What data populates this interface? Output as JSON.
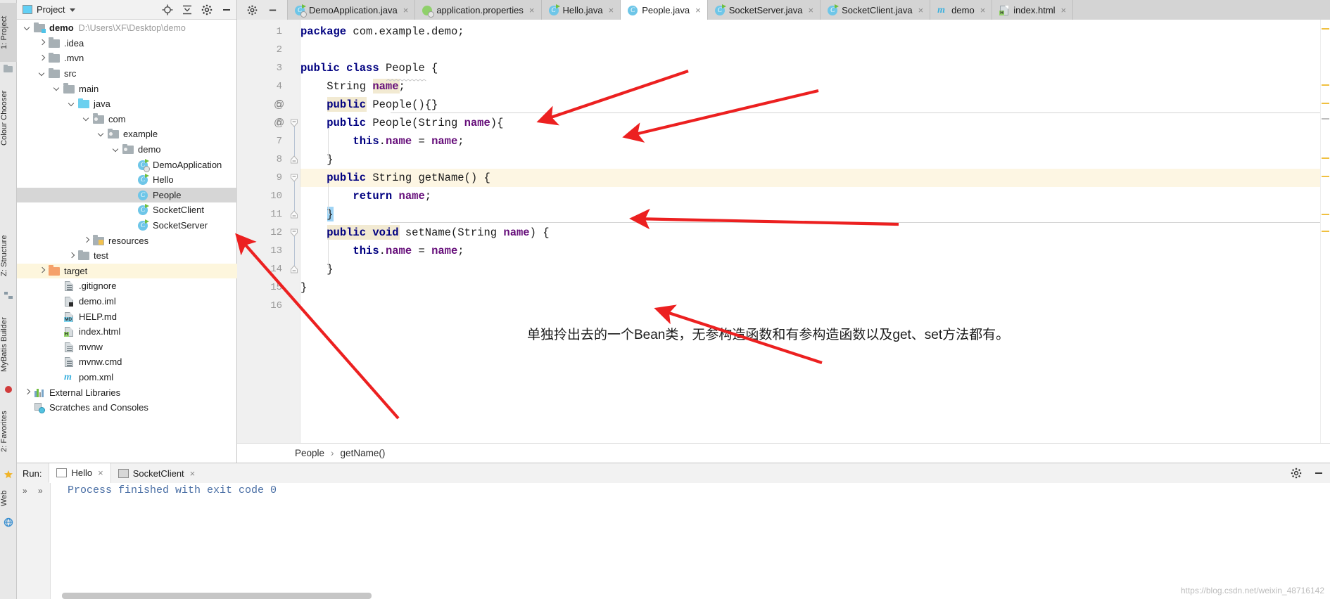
{
  "left_rail": {
    "items": [
      {
        "label": "1: Project",
        "selected": true,
        "icon": "project-icon"
      },
      {
        "label": "Colour Chooser",
        "selected": false,
        "icon": "palette-icon"
      },
      {
        "label": "Z: Structure",
        "selected": false,
        "icon": "structure-icon"
      },
      {
        "label": "MyBatis Builder",
        "selected": false,
        "icon": "mybatis-icon"
      },
      {
        "label": "2: Favorites",
        "selected": false,
        "icon": "star-icon"
      },
      {
        "label": "Web",
        "selected": false,
        "icon": "web-icon"
      }
    ]
  },
  "project_panel": {
    "title": "Project",
    "header_icons": [
      "locate-icon",
      "collapse-all-icon",
      "settings-gear-icon",
      "hide-icon"
    ],
    "tree": [
      {
        "label": "demo",
        "path": "D:\\Users\\XF\\Desktop\\demo",
        "depth": 0,
        "arrow": "down",
        "icon": "module-folder",
        "bold": true,
        "state": "none"
      },
      {
        "label": ".idea",
        "path": "",
        "depth": 1,
        "arrow": "right",
        "icon": "folder-grey",
        "bold": false,
        "state": "none"
      },
      {
        "label": ".mvn",
        "path": "",
        "depth": 1,
        "arrow": "right",
        "icon": "folder-grey",
        "bold": false,
        "state": "none"
      },
      {
        "label": "src",
        "path": "",
        "depth": 1,
        "arrow": "down",
        "icon": "folder-grey",
        "bold": false,
        "state": "none"
      },
      {
        "label": "main",
        "path": "",
        "depth": 2,
        "arrow": "down",
        "icon": "folder-grey",
        "bold": false,
        "state": "none"
      },
      {
        "label": "java",
        "path": "",
        "depth": 3,
        "arrow": "down",
        "icon": "folder-blue",
        "bold": false,
        "state": "none"
      },
      {
        "label": "com",
        "path": "",
        "depth": 4,
        "arrow": "down",
        "icon": "folder-package",
        "bold": false,
        "state": "none"
      },
      {
        "label": "example",
        "path": "",
        "depth": 5,
        "arrow": "down",
        "icon": "folder-package",
        "bold": false,
        "state": "none"
      },
      {
        "label": "demo",
        "path": "",
        "depth": 6,
        "arrow": "down",
        "icon": "folder-package",
        "bold": false,
        "state": "none"
      },
      {
        "label": "DemoApplication",
        "path": "",
        "depth": 7,
        "arrow": "none",
        "icon": "java-class-spring",
        "bold": false,
        "state": "none"
      },
      {
        "label": "Hello",
        "path": "",
        "depth": 7,
        "arrow": "none",
        "icon": "java-class-run",
        "bold": false,
        "state": "none"
      },
      {
        "label": "People",
        "path": "",
        "depth": 7,
        "arrow": "none",
        "icon": "java-class",
        "bold": false,
        "state": "selected-grey"
      },
      {
        "label": "SocketClient",
        "path": "",
        "depth": 7,
        "arrow": "none",
        "icon": "java-class-run",
        "bold": false,
        "state": "none"
      },
      {
        "label": "SocketServer",
        "path": "",
        "depth": 7,
        "arrow": "none",
        "icon": "java-class-run",
        "bold": false,
        "state": "none"
      },
      {
        "label": "resources",
        "path": "",
        "depth": 4,
        "arrow": "right",
        "icon": "folder-resources",
        "bold": false,
        "state": "none"
      },
      {
        "label": "test",
        "path": "",
        "depth": 3,
        "arrow": "right",
        "icon": "folder-grey",
        "bold": false,
        "state": "none"
      },
      {
        "label": "target",
        "path": "",
        "depth": 1,
        "arrow": "right",
        "icon": "folder-orange",
        "bold": false,
        "state": "selected-yellow"
      },
      {
        "label": ".gitignore",
        "path": "",
        "depth": 2,
        "arrow": "none",
        "icon": "file-plain",
        "bold": false,
        "state": "none"
      },
      {
        "label": "demo.iml",
        "path": "",
        "depth": 2,
        "arrow": "none",
        "icon": "file-iml",
        "bold": false,
        "state": "none"
      },
      {
        "label": "HELP.md",
        "path": "",
        "depth": 2,
        "arrow": "none",
        "icon": "file-md",
        "bold": false,
        "state": "none"
      },
      {
        "label": "index.html",
        "path": "",
        "depth": 2,
        "arrow": "none",
        "icon": "file-html",
        "bold": false,
        "state": "none"
      },
      {
        "label": "mvnw",
        "path": "",
        "depth": 2,
        "arrow": "none",
        "icon": "file-plain",
        "bold": false,
        "state": "none"
      },
      {
        "label": "mvnw.cmd",
        "path": "",
        "depth": 2,
        "arrow": "none",
        "icon": "file-plain",
        "bold": false,
        "state": "none"
      },
      {
        "label": "pom.xml",
        "path": "",
        "depth": 2,
        "arrow": "none",
        "icon": "maven-m",
        "bold": false,
        "state": "none"
      },
      {
        "label": "External Libraries",
        "path": "",
        "depth": 0,
        "arrow": "right",
        "icon": "libraries-icon",
        "bold": false,
        "state": "none"
      },
      {
        "label": "Scratches and Consoles",
        "path": "",
        "depth": 0,
        "arrow": "none",
        "icon": "scratches-icon",
        "bold": false,
        "state": "none"
      }
    ]
  },
  "editor": {
    "tabs": [
      {
        "label": "DemoApplication.java",
        "icon": "java-class-spring",
        "active": false
      },
      {
        "label": "application.properties",
        "icon": "properties-icon",
        "active": false
      },
      {
        "label": "Hello.java",
        "icon": "java-class-run",
        "active": false
      },
      {
        "label": "People.java",
        "icon": "java-class",
        "active": true
      },
      {
        "label": "SocketServer.java",
        "icon": "java-class-run",
        "active": false
      },
      {
        "label": "SocketClient.java",
        "icon": "java-class-run",
        "active": false
      },
      {
        "label": "demo",
        "icon": "maven-m",
        "active": false
      },
      {
        "label": "index.html",
        "icon": "file-html",
        "active": false
      }
    ],
    "close_glyph": "×",
    "gutter_marks": [
      {
        "line": 5,
        "glyph": "@"
      },
      {
        "line": 6,
        "glyph": "@"
      }
    ],
    "line_numbers": [
      "1",
      "2",
      "3",
      "4",
      "5",
      "6",
      "7",
      "8",
      "9",
      "10",
      "11",
      "12",
      "13",
      "14",
      "15",
      "16"
    ],
    "code_lines": [
      {
        "n": 1,
        "text": "package com.example.demo;"
      },
      {
        "n": 2,
        "text": ""
      },
      {
        "n": 3,
        "text": "public class People {"
      },
      {
        "n": 4,
        "text": "    String name;"
      },
      {
        "n": 5,
        "text": "    public People(){}"
      },
      {
        "n": 6,
        "text": "    public People(String name){"
      },
      {
        "n": 7,
        "text": "        this.name = name;"
      },
      {
        "n": 8,
        "text": "    }"
      },
      {
        "n": 9,
        "text": "    public String getName() {"
      },
      {
        "n": 10,
        "text": "        return name;"
      },
      {
        "n": 11,
        "text": "    }"
      },
      {
        "n": 12,
        "text": "    public void setName(String name) {"
      },
      {
        "n": 13,
        "text": "        this.name = name;"
      },
      {
        "n": 14,
        "text": "    }"
      },
      {
        "n": 15,
        "text": "}"
      },
      {
        "n": 16,
        "text": ""
      }
    ],
    "annotation_note": "单独拎出去的一个Bean类，无参构造函数和有参构造函数以及get、set方法都有。",
    "caret_line": 9
  },
  "breadcrumb": {
    "items": [
      "People",
      "getName()"
    ],
    "separator": "›"
  },
  "run_panel": {
    "label": "Run:",
    "tabs": [
      {
        "label": "Hello",
        "active": true
      },
      {
        "label": "SocketClient",
        "active": false
      }
    ],
    "close_glyph": "×",
    "right_icons": [
      "gear-icon",
      "minimize-icon"
    ],
    "console_output": "Process finished with exit code 0",
    "nav_chevrons": [
      "»",
      "»"
    ]
  },
  "watermark": "https://blog.csdn.net/weixin_48716142",
  "colors": {
    "accent_blue": "#6ec6e8",
    "keyword": "#000080",
    "field": "#660e7a",
    "caret_line": "#fdf6e3",
    "selection_grey": "#d6d6d6",
    "selection_yellow": "#fdf6dd",
    "annotation_red": "#ec2020",
    "console_text": "#4a6fa5"
  }
}
